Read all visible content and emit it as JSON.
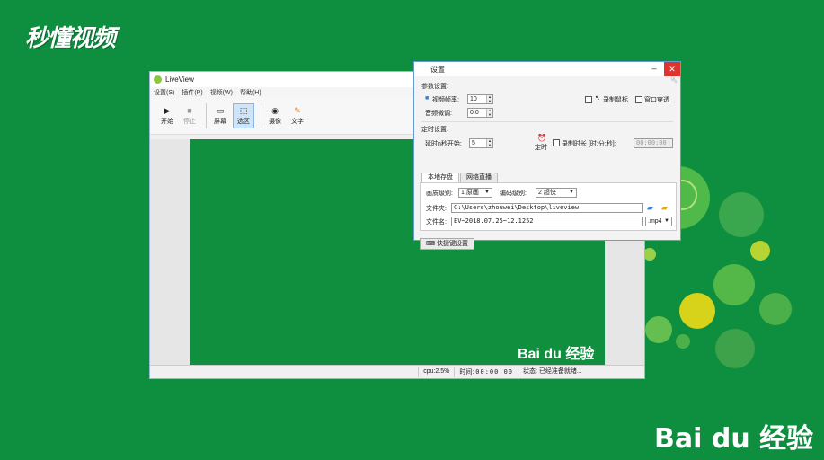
{
  "watermark": {
    "top_left": "秒懂视频",
    "mid": "Bai du 经验",
    "bottom_right": "Bai du 经验"
  },
  "main_window": {
    "title": "LiveView",
    "menu": [
      "设置(S)",
      "插件(P)",
      "视频(W)",
      "帮助(H)"
    ],
    "toolbar": {
      "start": "开始",
      "stop": "停止",
      "screen": "屏幕",
      "region": "选区",
      "camera": "摄像",
      "text": "文字"
    },
    "status": {
      "cpu": "cpu:2.5%",
      "time_label": "时间:",
      "time_value": "00:00:00",
      "state": "状态: 已经准备就绪..."
    }
  },
  "settings": {
    "title": "设置",
    "minimize": "–",
    "close": "✕",
    "section_params": "参数设置:",
    "video_fps_label": "视频帧率:",
    "video_fps_value": "10",
    "audio_tune_label": "音频微调:",
    "audio_tune_value": "0.0",
    "record_cursor_label": "录制鼠标",
    "window_through_label": "窗口穿透",
    "section_timer": "定时设置:",
    "delay_label": "延时n秒开始:",
    "delay_value": "5",
    "timer_label": "定时",
    "record_duration_label": "录制时长 [时:分:秒]:",
    "record_duration_value": "00:00:00",
    "tabs": [
      "本地存盘",
      "网络直播"
    ],
    "quality_label": "画质级别:",
    "quality_value": "1 原画",
    "encode_label": "编码级别:",
    "encode_value": "2 超快",
    "folder_label": "文件夹:",
    "folder_value": "C:\\Users\\zhouwei\\Desktop\\liveview",
    "filename_label": "文件名:",
    "filename_value": "EV~2018.07.25~12.1252",
    "ext_value": ".mp4",
    "shortcut_button": "快捷键设置"
  },
  "colors": {
    "background": "#0e8e3f",
    "close": "#e0322e",
    "accent": "#8cc63f"
  }
}
